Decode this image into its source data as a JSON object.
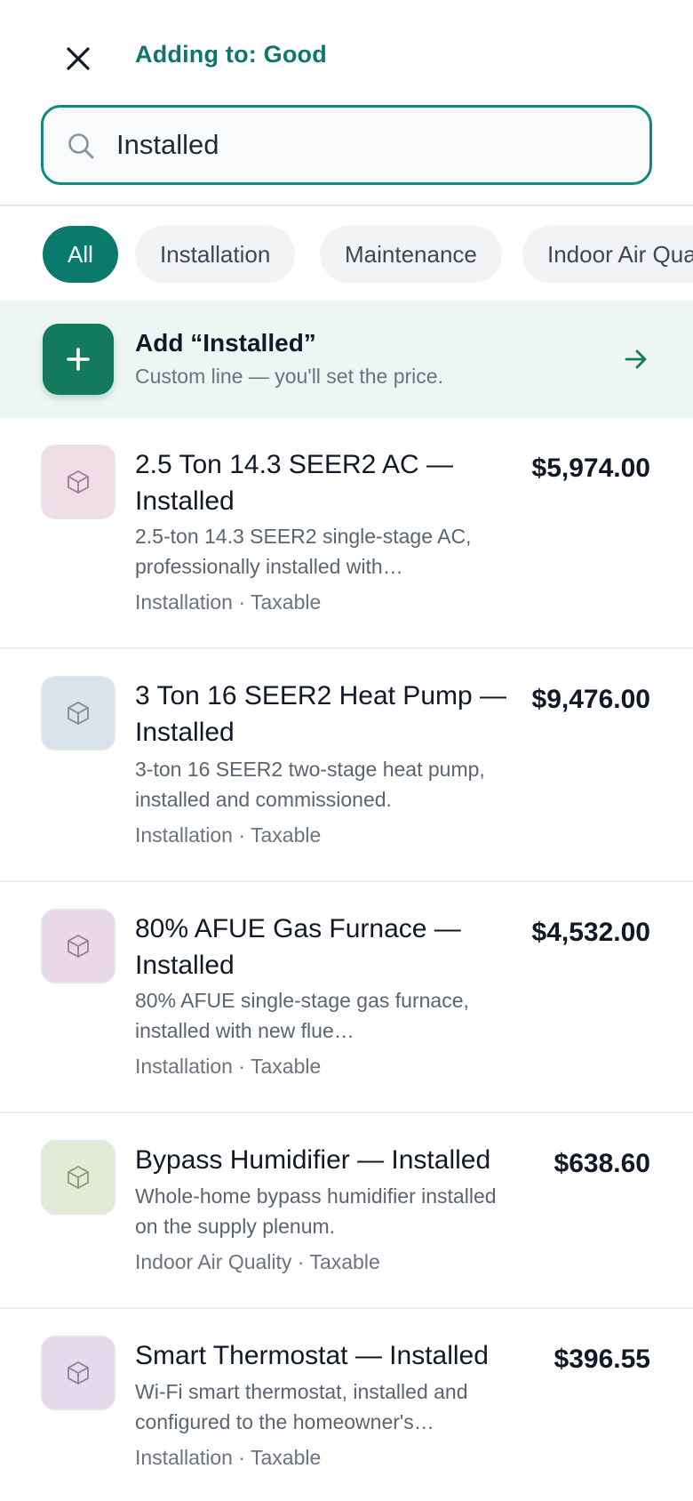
{
  "header": {
    "adding_to": "Adding to: Good",
    "close_icon": "close-icon"
  },
  "search": {
    "value": "Installed",
    "icon": "search-icon"
  },
  "filters": [
    {
      "label": "All",
      "active": true
    },
    {
      "label": "Installation",
      "active": false
    },
    {
      "label": "Maintenance",
      "active": false
    },
    {
      "label": "Indoor Air Quality",
      "active": false
    }
  ],
  "custom_line": {
    "title": "Add “Installed”",
    "subtitle": "Custom line — you'll set the price.",
    "plus_icon": "plus-icon",
    "arrow_icon": "arrow-right-icon",
    "accent": "#137a5c"
  },
  "items": [
    {
      "title": "2.5 Ton 14.3 SEER2 AC — Installed",
      "description": "2.5-ton 14.3 SEER2 single-stage AC, professionally installed with…",
      "category": "Installation",
      "tax": "Taxable",
      "price": "$5,974.00",
      "thumb_color": "#f1dde6",
      "icon": "box-icon"
    },
    {
      "title": "3 Ton 16 SEER2 Heat Pump — Installed",
      "description": "3-ton 16 SEER2 two-stage heat pump, installed and commissioned.",
      "category": "Installation",
      "tax": "Taxable",
      "price": "$9,476.00",
      "thumb_color": "#d8e3ea",
      "icon": "box-icon"
    },
    {
      "title": "80% AFUE Gas Furnace — Installed",
      "description": "80% AFUE single-stage gas furnace, installed with new flue…",
      "category": "Installation",
      "tax": "Taxable",
      "price": "$4,532.00",
      "thumb_color": "#ead9ea",
      "icon": "box-icon"
    },
    {
      "title": "Bypass Humidifier — Installed",
      "description": "Whole-home bypass humidifier installed on the supply plenum.",
      "category": "Indoor Air Quality",
      "tax": "Taxable",
      "price": "$638.60",
      "thumb_color": "#e3ead6",
      "icon": "box-icon"
    },
    {
      "title": "Smart Thermostat — Installed",
      "description": "Wi-Fi smart thermostat, installed and configured to the homeowner's…",
      "category": "Installation",
      "tax": "Taxable",
      "price": "$396.55",
      "thumb_color": "#e2dcec",
      "icon": "box-icon"
    }
  ]
}
